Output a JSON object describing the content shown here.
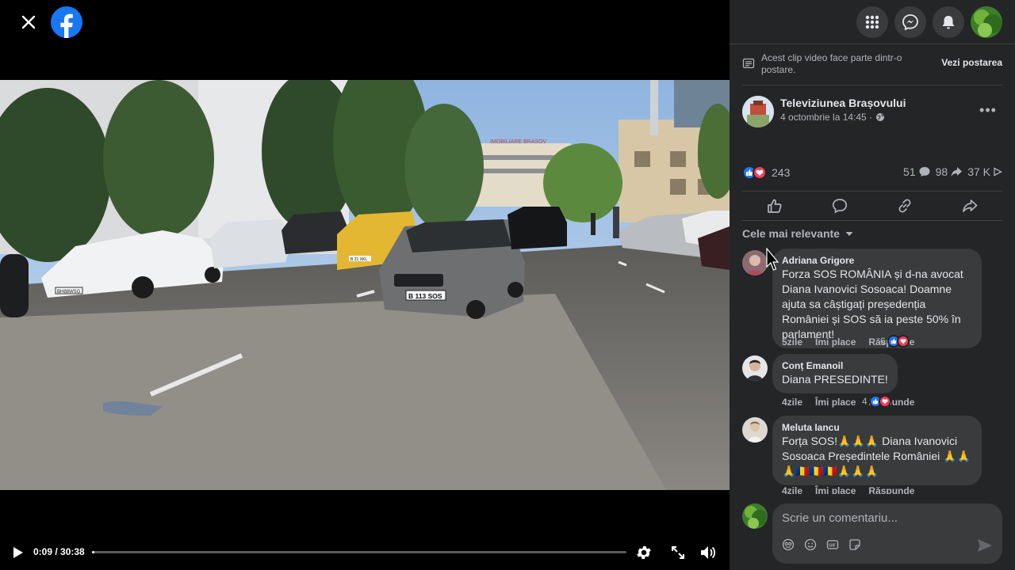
{
  "video": {
    "time": "0:09 / 30:38",
    "progress": 0.005,
    "plate_front": "B 113 SOS",
    "plate_left": "BH88WSG",
    "plate_yellow": "B 21 XKL",
    "building_sign": "IMOBILIARE BRASOV"
  },
  "topbar": {
    "icons": [
      "menu-grid-icon",
      "messenger-icon",
      "bell-icon",
      "profile-avatar"
    ]
  },
  "notice": {
    "text": "Acest clip video face parte dintr-o postare.",
    "link": "Vezi postarea"
  },
  "post": {
    "page_name": "Televiziunea Brașovului",
    "date": "4 octombrie la 14:45 ·",
    "reactions_count": "243",
    "comments_count": "51",
    "shares_count": "98",
    "views_count": "37 K"
  },
  "sort_label": "Cele mai relevante",
  "comments": [
    {
      "author": "Adriana Grigore",
      "text": "Forza SOS ROMÂNIA și d-na avocat Diana Ivanovici Sosoaca! Doamne ajuta sa câștigați președenția României și SOS să ia peste 50% în parlament!",
      "time": "5zile",
      "like": "Îmi place",
      "reply": "Răspunde",
      "reactions": "6"
    },
    {
      "author": "Conț Emanoil",
      "text": "Diana PRESEDINTE!",
      "time": "4zile",
      "like": "Îmi place",
      "reply": "Răspunde",
      "reactions": "4"
    },
    {
      "author": "Meluta Iancu",
      "text": "Forța SOS!🙏🙏🙏 Diana Ivanovici Sosoaca Președintele României 🙏🙏🙏🇷🇴🇷🇴🇷🇴🙏🙏🙏",
      "time": "4zile",
      "like": "Îmi place",
      "reply": "Răspunde"
    }
  ],
  "composer": {
    "placeholder": "Scrie un comentariu..."
  },
  "colors": {
    "panel_bg": "#242526",
    "bubble_bg": "#3a3b3c",
    "facebook_blue": "#1877f2",
    "like_blue": "#2078f4",
    "love_red": "#f33e58"
  }
}
